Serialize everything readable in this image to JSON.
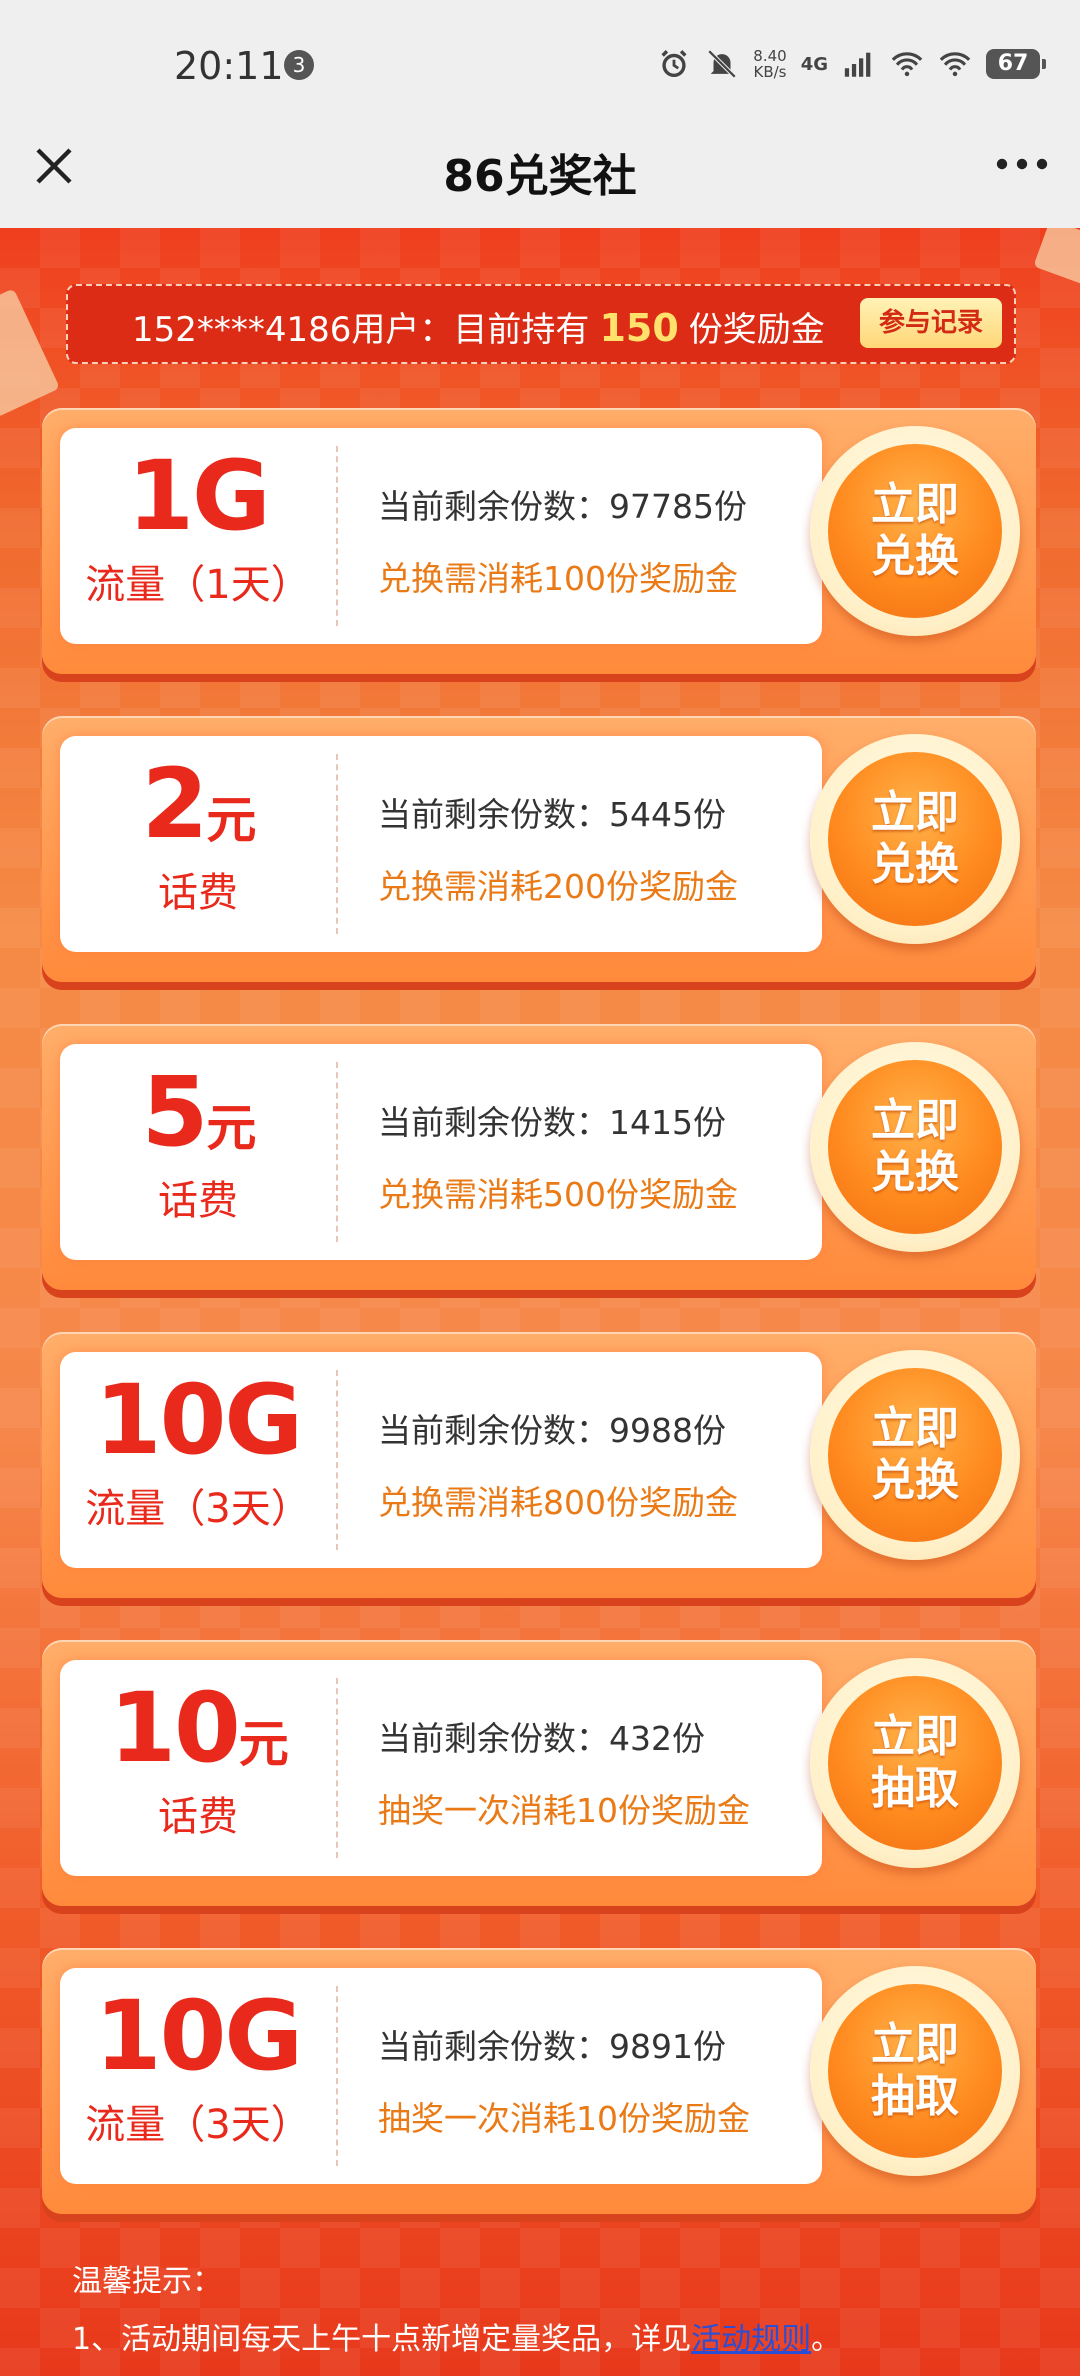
{
  "status_bar": {
    "time": "20:11",
    "notif_count": "3",
    "speed_value": "8.40",
    "speed_unit": "KB/s",
    "network": "4G",
    "battery": "67"
  },
  "nav": {
    "title": "86兑奖社"
  },
  "user": {
    "prefix": "152****4186用户：目前持有",
    "count": "150",
    "suffix": "份奖励金",
    "record_label": "参与记录"
  },
  "prizes": [
    {
      "main": "1G",
      "unit": "",
      "sub": "流量（1天）",
      "remain": "当前剩余份数：97785份",
      "cost": "兑换需消耗100份奖励金",
      "btn1": "立即",
      "btn2": "兑换"
    },
    {
      "main": "2",
      "unit": "元",
      "sub": "话费",
      "remain": "当前剩余份数：5445份",
      "cost": "兑换需消耗200份奖励金",
      "btn1": "立即",
      "btn2": "兑换"
    },
    {
      "main": "5",
      "unit": "元",
      "sub": "话费",
      "remain": "当前剩余份数：1415份",
      "cost": "兑换需消耗500份奖励金",
      "btn1": "立即",
      "btn2": "兑换"
    },
    {
      "main": "10G",
      "unit": "",
      "sub": "流量（3天）",
      "remain": "当前剩余份数：9988份",
      "cost": "兑换需消耗800份奖励金",
      "btn1": "立即",
      "btn2": "兑换"
    },
    {
      "main": "10",
      "unit": "元",
      "sub": "话费",
      "remain": "当前剩余份数：432份",
      "cost": "抽奖一次消耗10份奖励金",
      "btn1": "立即",
      "btn2": "抽取"
    },
    {
      "main": "10G",
      "unit": "",
      "sub": "流量（3天）",
      "remain": "当前剩余份数：9891份",
      "cost": "抽奖一次消耗10份奖励金",
      "btn1": "立即",
      "btn2": "抽取"
    }
  ],
  "tips": {
    "title": "温馨提示：",
    "line1_text": "1、活动期间每天上午十点新增定量奖品，详见",
    "line1_link": "活动规则",
    "line1_end": "。"
  }
}
